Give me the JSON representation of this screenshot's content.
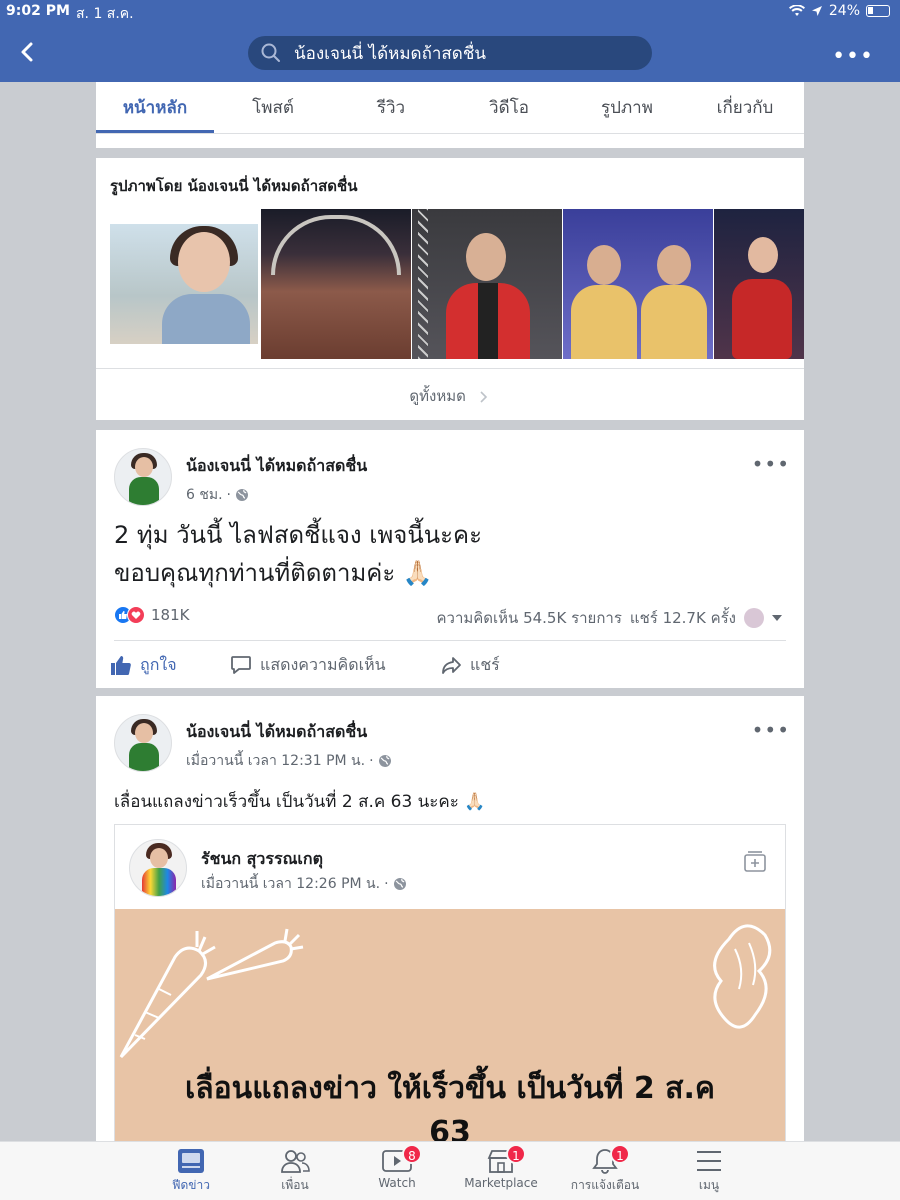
{
  "status_bar": {
    "time": "9:02 PM",
    "date": "ส. 1 ส.ค.",
    "battery": "24%"
  },
  "header": {
    "search_text": "น้องเจนนี่ ได้หมดถ้าสดชื่น",
    "icons": [
      "back-chevron-icon",
      "search-icon",
      "more-icon"
    ]
  },
  "tabs": [
    {
      "label": "หน้าหลัก",
      "active": true
    },
    {
      "label": "โพสต์",
      "active": false
    },
    {
      "label": "รีวิว",
      "active": false
    },
    {
      "label": "วิดีโอ",
      "active": false
    },
    {
      "label": "รูปภาพ",
      "active": false
    },
    {
      "label": "เกี่ยวกับ",
      "active": false
    }
  ],
  "photos": {
    "title": "รูปภาพโดย น้องเจนนี่ ได้หมดถ้าสดชื่น",
    "see_all": "ดูทั้งหมด"
  },
  "post1": {
    "author": "น้องเจนนี่ ได้หมดถ้าสดชื่น",
    "time": "6 ชม.",
    "text_line1": "2 ทุ่ม วันนี้ ไลฟสดชี้แจง เพจนี้นะคะ",
    "text_line2": "ขอบคุณทุกท่านที่ติดตามค่ะ 🙏🏻",
    "reactions_count": "181K",
    "comments": "ความคิดเห็น 54.5K รายการ",
    "shares": "แชร์ 12.7K ครั้ง",
    "actions": {
      "like": "ถูกใจ",
      "comment": "แสดงความคิดเห็น",
      "share": "แชร์"
    }
  },
  "post2": {
    "author": "น้องเจนนี่ ได้หมดถ้าสดชื่น",
    "time": "เมื่อวานนี้ เวลา 12:31 PM น.",
    "text": "เลื่อนแถลงข่าวเร็วขึ้น เป็นวันที่ 2 ส.ค 63 นะคะ 🙏🏻",
    "shared": {
      "author": "รัชนก สุวรรณเกตุ",
      "time": "เมื่อวานนี้ เวลา 12:26 PM น.",
      "banner_line1": "เลื่อนแถลงข่าว ให้เร็วขึ้น เป็นวันที่ 2 ส.ค",
      "banner_line2": "63",
      "banner_color": "#e8c4a6"
    }
  },
  "bottom_nav": [
    {
      "label": "ฟีดข่าว",
      "icon": "news-feed-icon",
      "active": true,
      "badge": ""
    },
    {
      "label": "เพื่อน",
      "icon": "friends-icon",
      "active": false,
      "badge": ""
    },
    {
      "label": "Watch",
      "icon": "watch-icon",
      "active": false,
      "badge": "8"
    },
    {
      "label": "Marketplace",
      "icon": "marketplace-icon",
      "active": false,
      "badge": "1"
    },
    {
      "label": "การแจ้งเตือน",
      "icon": "bell-icon",
      "active": false,
      "badge": "1"
    },
    {
      "label": "เมนู",
      "icon": "menu-icon",
      "active": false,
      "badge": ""
    }
  ],
  "colors": {
    "brand": "#4267b2",
    "badge": "#f02849"
  }
}
